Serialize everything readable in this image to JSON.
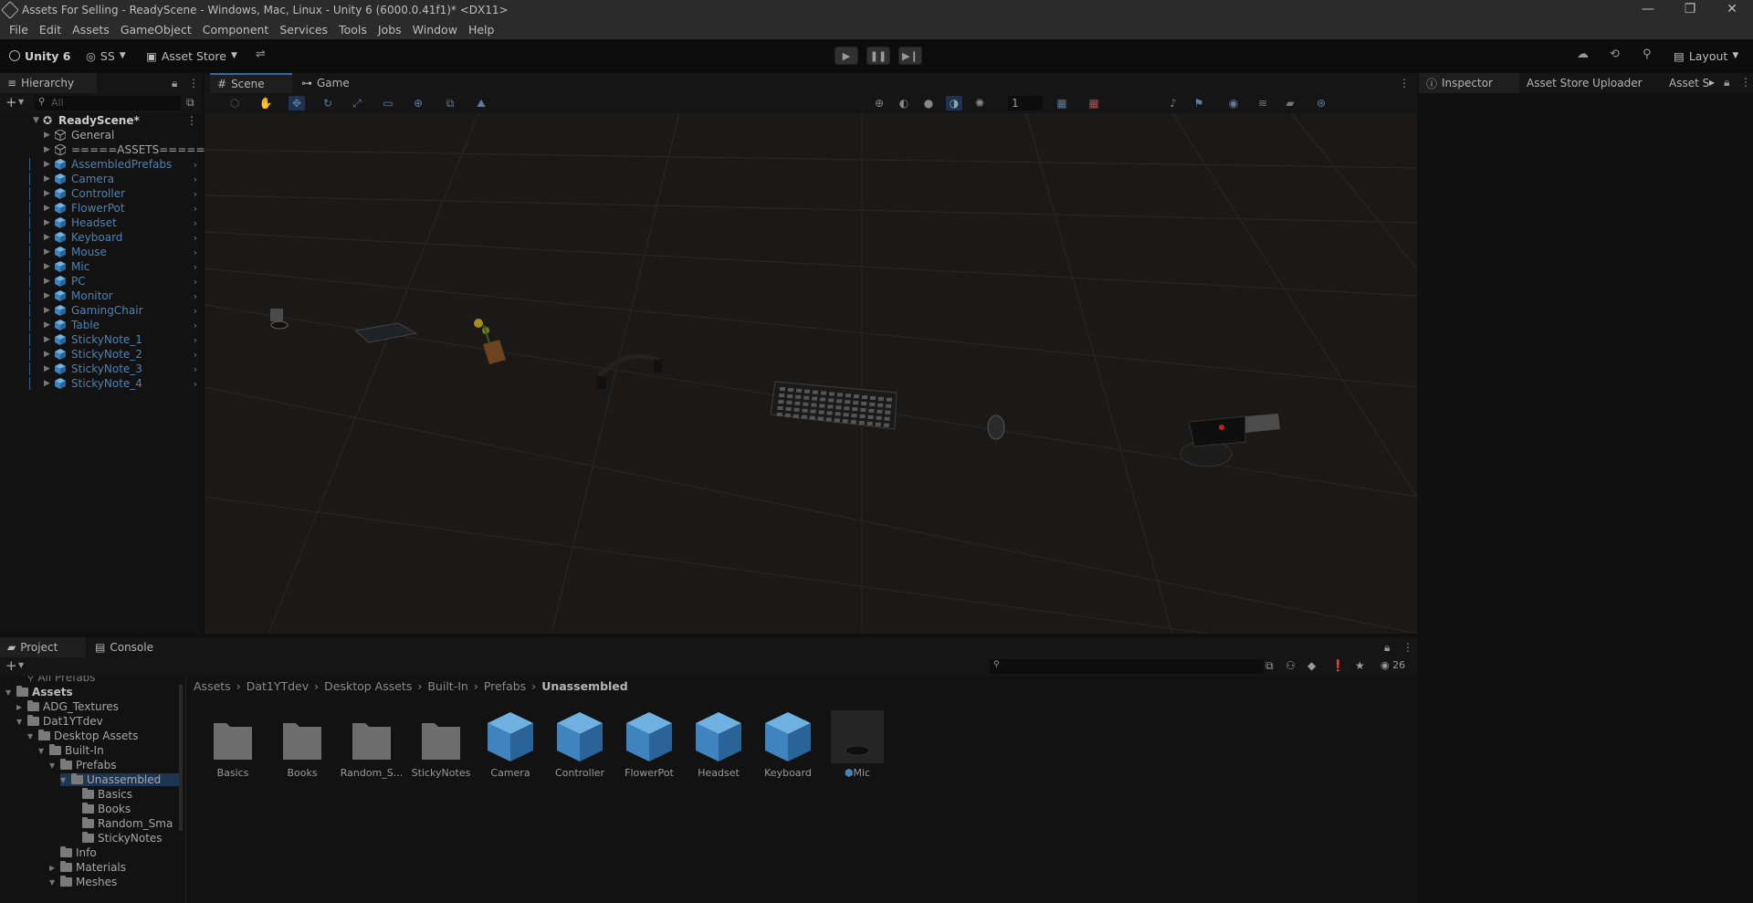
{
  "window": {
    "title": "Assets For Selling - ReadyScene - Windows, Mac, Linux - Unity 6 (6000.0.41f1)* <DX11>",
    "controls": [
      "—",
      "❐",
      "✕"
    ]
  },
  "menu": [
    "File",
    "Edit",
    "Assets",
    "GameObject",
    "Component",
    "Services",
    "Tools",
    "Jobs",
    "Window",
    "Help"
  ],
  "toolbar": {
    "unity_label": "Unity 6",
    "account_label": "SS",
    "asset_store_label": "Asset Store",
    "layout_label": "Layout"
  },
  "hierarchy": {
    "tab_label": "Hierarchy",
    "search_placeholder": "All",
    "scene_name": "ReadyScene*",
    "items": [
      {
        "label": "General",
        "style": "grey",
        "type": "object"
      },
      {
        "label": "=====ASSETS=====",
        "style": "grey",
        "type": "object"
      },
      {
        "label": "AssembledPrefabs",
        "style": "blue",
        "type": "prefab"
      },
      {
        "label": "Camera",
        "style": "blue",
        "type": "prefab"
      },
      {
        "label": "Controller",
        "style": "blue",
        "type": "prefab"
      },
      {
        "label": "FlowerPot",
        "style": "blue",
        "type": "prefab"
      },
      {
        "label": "Headset",
        "style": "blue",
        "type": "prefab"
      },
      {
        "label": "Keyboard",
        "style": "blue",
        "type": "prefab"
      },
      {
        "label": "Mouse",
        "style": "blue",
        "type": "prefab"
      },
      {
        "label": "Mic",
        "style": "blue",
        "type": "prefab"
      },
      {
        "label": "PC",
        "style": "blue",
        "type": "prefab"
      },
      {
        "label": "Monitor",
        "style": "blue",
        "type": "prefab"
      },
      {
        "label": "GamingChair",
        "style": "blue",
        "type": "prefab"
      },
      {
        "label": "Table",
        "style": "blue",
        "type": "prefab"
      },
      {
        "label": "StickyNote_1",
        "style": "blue",
        "type": "prefab"
      },
      {
        "label": "StickyNote_2",
        "style": "blue",
        "type": "prefab"
      },
      {
        "label": "StickyNote_3",
        "style": "blue",
        "type": "prefab"
      },
      {
        "label": "StickyNote_4",
        "style": "blue",
        "type": "prefab"
      }
    ]
  },
  "scene": {
    "tabs": [
      "Scene",
      "Game"
    ],
    "camera_value": "1"
  },
  "inspector": {
    "tabs": [
      "Inspector",
      "Asset Store Uploader",
      "Asset S"
    ]
  },
  "project": {
    "tabs": [
      "Project",
      "Console"
    ],
    "item_count": "26",
    "breadcrumb": [
      "Assets",
      "Dat1YTdev",
      "Desktop Assets",
      "Built-In",
      "Prefabs",
      "Unassembled"
    ],
    "tree_top_cut": "All Prefabs",
    "tree": [
      {
        "label": "Assets"
      },
      {
        "label": "ADG_Textures"
      },
      {
        "label": "Dat1YTdev"
      },
      {
        "label": "Desktop Assets"
      },
      {
        "label": "Built-In"
      },
      {
        "label": "Prefabs"
      },
      {
        "label": "Unassembled"
      },
      {
        "label": "Basics"
      },
      {
        "label": "Books"
      },
      {
        "label": "Random_Sma"
      },
      {
        "label": "StickyNotes"
      },
      {
        "label": "Info"
      },
      {
        "label": "Materials"
      },
      {
        "label": "Meshes"
      }
    ],
    "assets": [
      {
        "label": "Basics",
        "kind": "folder"
      },
      {
        "label": "Books",
        "kind": "folder"
      },
      {
        "label": "Random_S...",
        "kind": "folder"
      },
      {
        "label": "StickyNotes",
        "kind": "folder"
      },
      {
        "label": "Camera",
        "kind": "prefab"
      },
      {
        "label": "Controller",
        "kind": "prefab"
      },
      {
        "label": "FlowerPot",
        "kind": "prefab"
      },
      {
        "label": "Headset",
        "kind": "prefab"
      },
      {
        "label": "Keyboard",
        "kind": "prefab"
      },
      {
        "label": "Mic",
        "kind": "prefab-selected"
      }
    ]
  },
  "colors": {
    "prefab_blue": "#4a83b8",
    "accent": "#2d6aa8",
    "panel": "#121212"
  }
}
